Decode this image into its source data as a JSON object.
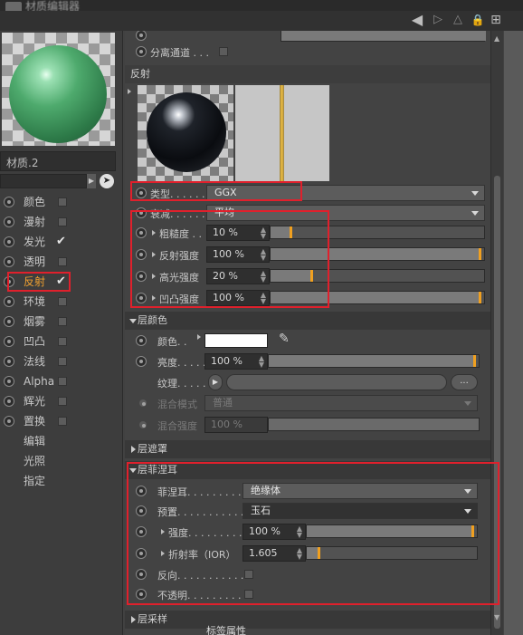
{
  "window": {
    "title": "材质编辑器"
  },
  "toolbar": {
    "back": "◀",
    "forward": "▷",
    "up": "△",
    "lock": "🔒",
    "newwin": "⊞"
  },
  "left": {
    "material_name": "材质.2",
    "channels": [
      {
        "label": "颜色",
        "checked": false
      },
      {
        "label": "漫射",
        "checked": false
      },
      {
        "label": "发光",
        "checked": true
      },
      {
        "label": "透明",
        "checked": false
      },
      {
        "label": "反射",
        "checked": true,
        "active": true
      },
      {
        "label": "环境",
        "checked": false
      },
      {
        "label": "烟雾",
        "checked": false
      },
      {
        "label": "凹凸",
        "checked": false
      },
      {
        "label": "法线",
        "checked": false
      },
      {
        "label": "Alpha",
        "checked": false
      },
      {
        "label": "辉光",
        "checked": false
      },
      {
        "label": "置换",
        "checked": false
      },
      {
        "label": "编辑"
      },
      {
        "label": "光照"
      },
      {
        "label": "指定"
      }
    ]
  },
  "right": {
    "separate_pass_label": "分离通道 . . .",
    "section_title": "反射",
    "type_label": "类型. . . . . .",
    "type_value": "GGX",
    "falloff_label": "衰减. . . . . .",
    "falloff_value": "平均",
    "roughness_label": "粗糙度 . .",
    "roughness_value": "10 %",
    "roughness_level": 0.1,
    "refl_strength_label": "反射强度",
    "refl_strength_value": "100 %",
    "refl_strength_level": 1.0,
    "spec_strength_label": "高光强度",
    "spec_strength_value": "20 %",
    "spec_strength_level": 0.2,
    "bump_strength_label": "凹凸强度",
    "bump_strength_value": "100 %",
    "bump_strength_level": 1.0,
    "layer_color_header": "层颜色",
    "color_label": "颜色. .",
    "brightness_label": "亮度. . . . . .",
    "brightness_value": "100 %",
    "brightness_level": 1.0,
    "texture_label": "纹理. . . . . .",
    "texture_more": "...",
    "blend_mode_label": "混合模式",
    "blend_mode_value": "普通",
    "blend_strength_label": "混合强度",
    "blend_strength_value": "100 %",
    "layer_mask_header": "层遮罩",
    "layer_fresnel_header": "层菲涅耳",
    "fresnel_label": "菲涅耳. . . . . . . . .",
    "fresnel_value": "绝缘体",
    "preset_label": "预置. . . . . . . . . . .",
    "preset_value": "玉石",
    "strength_label": "强度. . . . . . . . . . .",
    "strength_value": "100 %",
    "strength_level": 1.0,
    "ior_label": "折射率（IOR）",
    "ior_value": "1.605",
    "ior_level": 0.08,
    "invert_label": "反向. . . . . . . . . . .",
    "opaque_label": "不透明. . . . . . . . .",
    "layer_sampling_header": "层采样",
    "bottom_tab": "标签属性"
  },
  "colors": {
    "accent": "#f0a020",
    "highlight_box": "#e0202c",
    "active_channel": "#f0a030"
  }
}
